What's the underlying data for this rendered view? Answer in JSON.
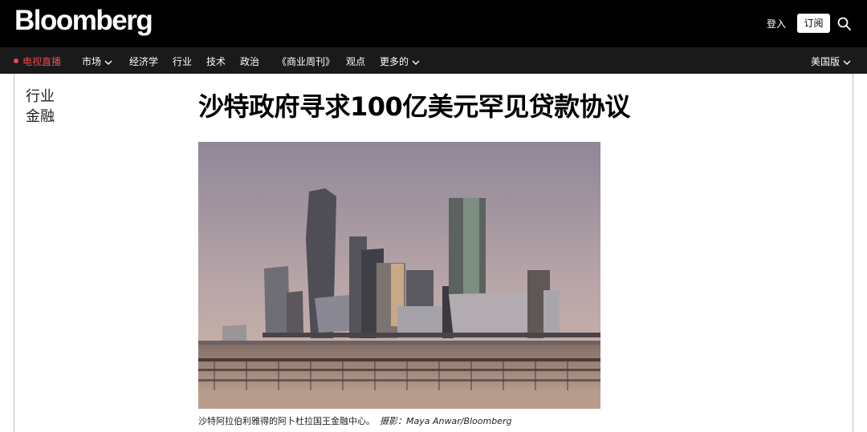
{
  "header": {
    "logo": "Bloomberg",
    "login_label": "登入",
    "subscribe_label": "订阅"
  },
  "nav": {
    "live_label": "电视直播",
    "items": [
      "市场",
      "经济学",
      "行业",
      "技术",
      "政治",
      "《商业周刊》",
      "观点",
      "更多的"
    ],
    "edition_label": "美国版"
  },
  "article": {
    "tags": [
      "行业",
      "金融"
    ],
    "headline": "沙特政府寻求100亿美元罕见贷款协议",
    "caption": "沙特阿拉伯利雅得的阿卜杜拉国王金融中心。",
    "credit_label": "摄影：",
    "credit": "Maya Anwar/Bloomberg"
  },
  "colors": {
    "topbar": "#000000",
    "navbar": "#1a1a1a",
    "live_accent": "#f04848"
  }
}
